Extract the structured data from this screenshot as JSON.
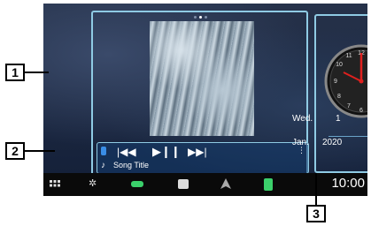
{
  "callouts": {
    "one": "1",
    "two": "2",
    "three": "3"
  },
  "player": {
    "song_title": "Song Title",
    "page_dots": 3,
    "active_dot": 1
  },
  "clock": {
    "day_name": "Wed.",
    "day": "1",
    "month": "Jan.",
    "year": "2020"
  },
  "taskbar": {
    "time": "10:00"
  },
  "colors": {
    "accent": "#8fcbe4",
    "green": "#3bd06b",
    "clock_hand": "#e0201e"
  },
  "icons": [
    "menu-grid-icon",
    "gear-icon",
    "battery-pill-icon",
    "media-square-icon",
    "navigation-arrow-icon",
    "phone-icon"
  ]
}
